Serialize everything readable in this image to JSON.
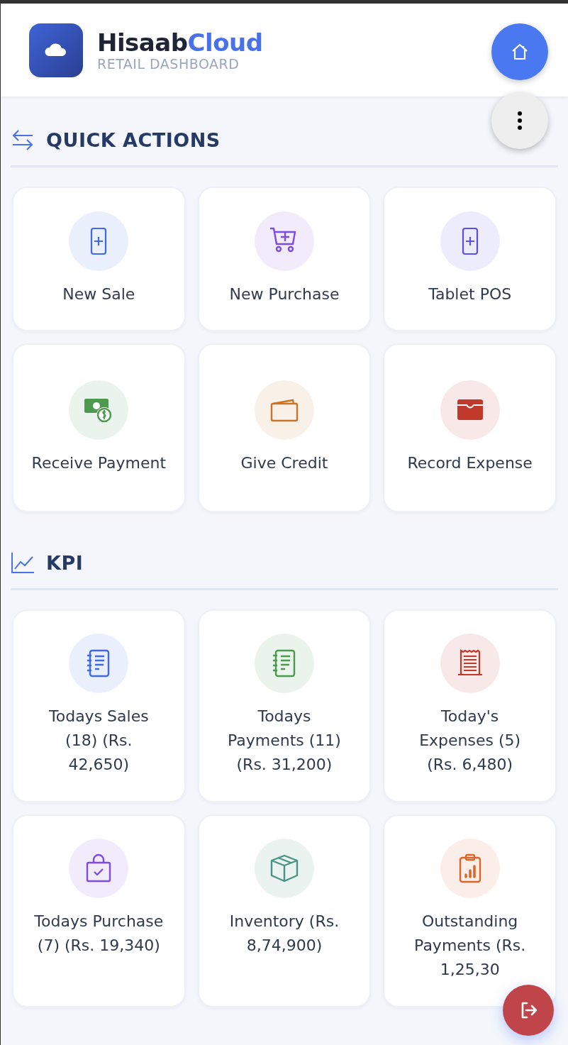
{
  "header": {
    "brand": {
      "main": "Hisaab",
      "accent": "Cloud"
    },
    "subtitle": "RETAIL DASHBOARD"
  },
  "sections": [
    {
      "kind": "actions",
      "title": "QUICK ACTIONS",
      "tiles": [
        {
          "kind": "tablet",
          "color": "#4169e1",
          "label": "New Sale"
        },
        {
          "kind": "cart",
          "color": "#7c4ddf",
          "label": "New Purchase"
        },
        {
          "kind": "tablet",
          "color": "#5b4fe0",
          "label": "Tablet POS"
        },
        {
          "kind": "cash",
          "color": "#4c9a4f",
          "label": "Receive Payment"
        },
        {
          "kind": "wallet",
          "color": "#c8742a",
          "label": "Give Credit"
        },
        {
          "kind": "purse",
          "color": "#c0392b",
          "label": "Record Expense"
        }
      ]
    },
    {
      "kind": "chart",
      "title": "KPI",
      "tiles": [
        {
          "kind": "ledger",
          "color": "#4169e1",
          "label": "Todays Sales (18) (Rs. 42,650)"
        },
        {
          "kind": "ledger",
          "color": "#4c9a4f",
          "label": "Todays Payments (11) (Rs. 31,200)"
        },
        {
          "kind": "receipt",
          "color": "#c0392b",
          "label": "Today's Expenses (5) (Rs. 6,480)"
        },
        {
          "kind": "bag",
          "color": "#7c4ddf",
          "label": "Todays Purchase (7) (Rs. 19,340)"
        },
        {
          "kind": "box",
          "color": "#4a9484",
          "label": "Inventory (Rs. 8,74,900)"
        },
        {
          "kind": "clipboard",
          "color": "#d9662a",
          "label": "Outstanding Payments (Rs. 1,25,30"
        }
      ]
    }
  ]
}
